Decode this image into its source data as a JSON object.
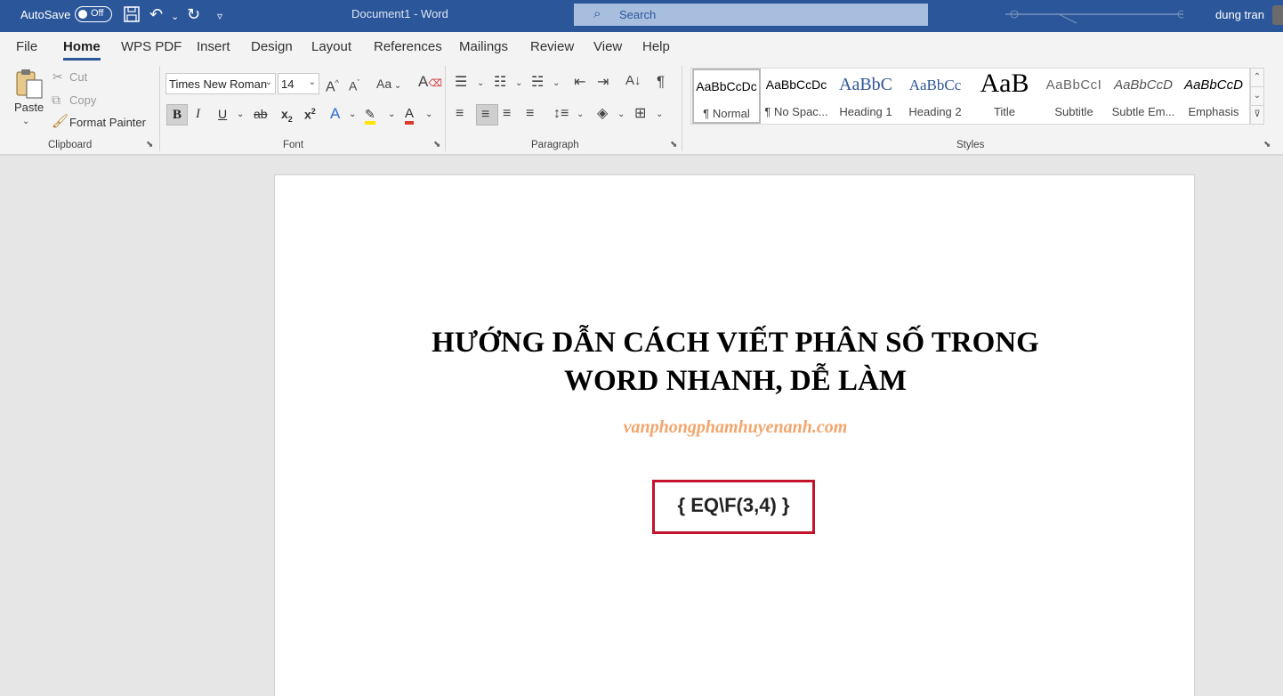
{
  "titlebar": {
    "autosave_label": "AutoSave",
    "autosave_state": "Off",
    "document_title": "Document1  -  Word",
    "search_placeholder": "Search",
    "user_name": "dung tran"
  },
  "tabs": [
    "File",
    "Home",
    "WPS PDF",
    "Insert",
    "Design",
    "Layout",
    "References",
    "Mailings",
    "Review",
    "View",
    "Help"
  ],
  "active_tab": "Home",
  "clipboard": {
    "paste": "Paste",
    "cut": "Cut",
    "copy": "Copy",
    "format_painter": "Format Painter",
    "group_label": "Clipboard"
  },
  "font": {
    "family": "Times New Roman",
    "size": "14",
    "case_label": "Aa",
    "group_label": "Font"
  },
  "paragraph": {
    "group_label": "Paragraph"
  },
  "styles": {
    "group_label": "Styles",
    "items": [
      {
        "preview": "AaBbCcDc",
        "name": "¶ Normal"
      },
      {
        "preview": "AaBbCcDc",
        "name": "¶ No Spac..."
      },
      {
        "preview": "AaBbC",
        "name": "Heading 1"
      },
      {
        "preview": "AaBbCc",
        "name": "Heading 2"
      },
      {
        "preview": "AaB",
        "name": "Title"
      },
      {
        "preview": "AaBbCcI",
        "name": "Subtitle"
      },
      {
        "preview": "AaBbCcD",
        "name": "Subtle Em..."
      },
      {
        "preview": "AaBbCcD",
        "name": "Emphasis"
      }
    ]
  },
  "document": {
    "heading_line1": "HƯỚNG DẪN CÁCH VIẾT PHÂN SỐ TRONG",
    "heading_line2": "WORD NHANH, DỄ LÀM",
    "website": "vanphongphamhuyenanh.com",
    "field_code": "{ EQ\\F(3,4) }"
  },
  "colors": {
    "titlebar": "#2b579a",
    "highlight_red": "#c3142b",
    "website_orange": "#f2a56d"
  }
}
